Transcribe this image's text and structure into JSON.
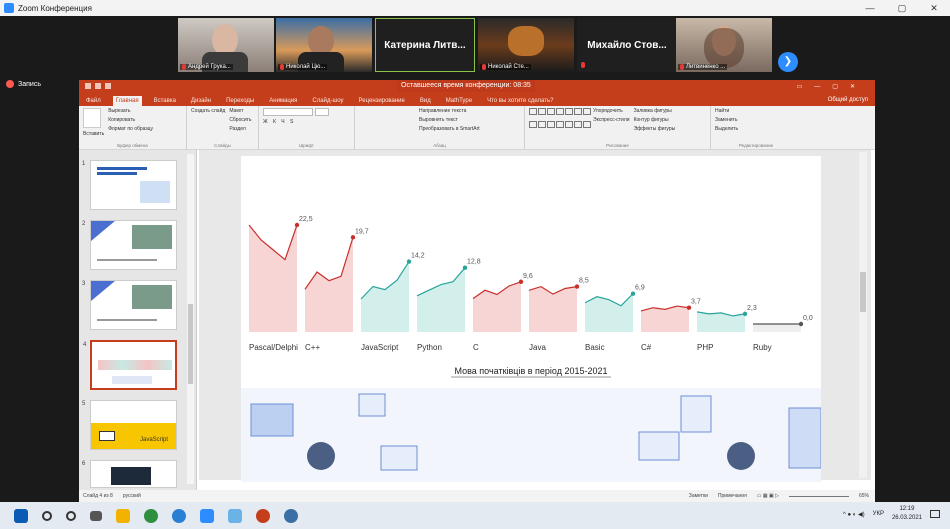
{
  "zoom": {
    "title": "Zoom Конференция",
    "record_label": "Запись",
    "participants": [
      {
        "name": "Андрей Грука...",
        "type": "video"
      },
      {
        "name": "Николай Цю...",
        "type": "video"
      },
      {
        "name": "Катерина Литв...",
        "type": "name"
      },
      {
        "name": "Николай Сте...",
        "type": "video"
      },
      {
        "name": "Михайло Стов...",
        "type": "name"
      },
      {
        "name": "Литвиненко ...",
        "type": "video"
      }
    ],
    "next_icon": "chevron-right-icon"
  },
  "ppt": {
    "timer": "Оставшееся время конференции: 08:35",
    "tabs": [
      "Файл",
      "Главная",
      "Вставка",
      "Дизайн",
      "Переходы",
      "Анимация",
      "Слайд-шоу",
      "Рецензирование",
      "Вид",
      "MathType",
      "Что вы хотите сделать?"
    ],
    "share": "Общий доступ",
    "clipboard": {
      "paste": "Вставить",
      "cut": "Вырезать",
      "copy": "Копировать",
      "format": "Формат по образцу",
      "label": "Буфер обмена"
    },
    "slides_group": {
      "new": "Создать слайд",
      "layout": "Макет",
      "reset": "Сбросить",
      "section": "Раздел",
      "label": "Слайды"
    },
    "font_label": "Шрифт",
    "paragraph": {
      "dir": "Направление текста",
      "align": "Выровнять текст",
      "convert": "Преобразовать в SmartArt",
      "label": "Абзац"
    },
    "drawing": {
      "arrange": "Упорядочить",
      "styles": "Экспресс-стили",
      "fill": "Заливка фигуры",
      "outline": "Контур фигуры",
      "effects": "Эффекты фигуры",
      "label": "Рисование"
    },
    "editing": {
      "find": "Найти",
      "replace": "Заменить",
      "select": "Выделить",
      "label": "Редактирование"
    },
    "status": {
      "slide": "Слайд 4 из 8",
      "lang": "русский",
      "notes": "Заметки",
      "comments": "Примечания",
      "zoom": "65%"
    }
  },
  "chart_data": {
    "type": "line",
    "title": "Мова початківців в період 2015-2021",
    "series": [
      {
        "name": "Pascal/Delphi",
        "end_value": 22.5,
        "color": "#c9302c",
        "fill": "#f7d5d5"
      },
      {
        "name": "C++",
        "end_value": 19.7,
        "color": "#c9302c",
        "fill": "#f7d5d5"
      },
      {
        "name": "JavaScript",
        "end_value": 14.2,
        "color": "#27a59a",
        "fill": "#d2efec"
      },
      {
        "name": "Python",
        "end_value": 12.8,
        "color": "#27a59a",
        "fill": "#d2efec"
      },
      {
        "name": "C",
        "end_value": 9.6,
        "color": "#c9302c",
        "fill": "#f7d5d5"
      },
      {
        "name": "Java",
        "end_value": 8.5,
        "color": "#c9302c",
        "fill": "#f7d5d5"
      },
      {
        "name": "Basic",
        "end_value": 6.9,
        "color": "#27a59a",
        "fill": "#d2efec"
      },
      {
        "name": "C#",
        "end_value": 3.7,
        "color": "#c9302c",
        "fill": "#f7d5d5"
      },
      {
        "name": "PHP",
        "end_value": 2.3,
        "color": "#27a59a",
        "fill": "#d2efec"
      },
      {
        "name": "Ruby",
        "end_value": 0.0,
        "color": "#555555",
        "fill": "#eeeeee"
      }
    ],
    "value_labels": [
      "22,5",
      "19,7",
      "14,2",
      "12,8",
      "9,6",
      "8,5",
      "6,9",
      "3,7",
      "2,3",
      "0,0"
    ]
  },
  "taskbar": {
    "lang": "УКР",
    "time": "12:19",
    "date": "26.03.2021"
  }
}
